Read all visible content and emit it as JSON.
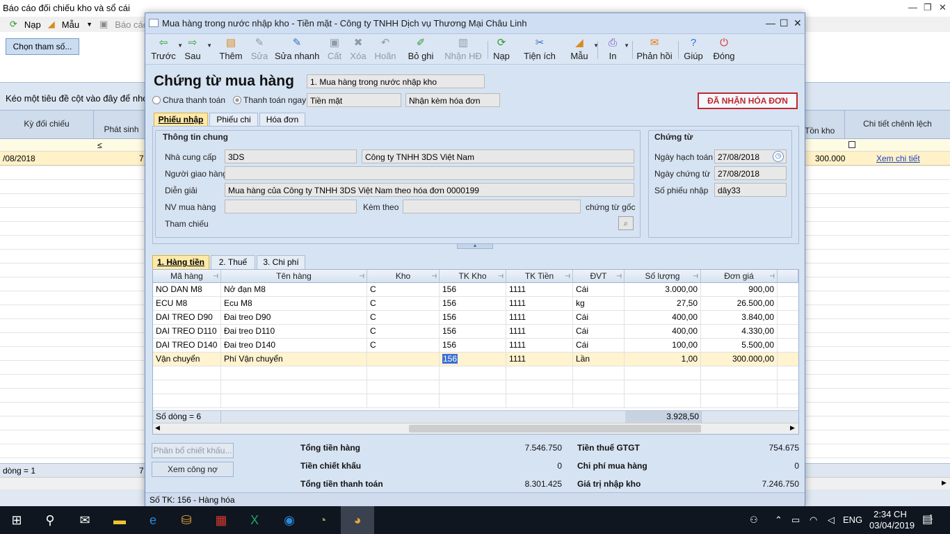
{
  "background_window": {
    "title": "Báo cáo đối chiếu kho và sổ cái",
    "toolbar": {
      "nap": "Nạp",
      "mau": "Mẫu",
      "bao_cao": "Báo cáo đ"
    },
    "chon_tham_so": "Chọn tham số...",
    "group_hint": "Kéo một tiêu đề cột vào đây để nhóm",
    "columns": {
      "ky_doi_chieu": "Kỳ đối chiếu",
      "phat_sinh": "Phát sinh",
      "ton_kho": "Tồn kho",
      "chi_tiet": "Chi tiết chênh lệch"
    },
    "filter_op": "≤",
    "row": {
      "ky": "/08/2018",
      "phat_sinh": "7",
      "ton_kho": "300.000",
      "link": "Xem chi tiết"
    },
    "footer_count": "dòng = 1",
    "footer_val": "7"
  },
  "dialog": {
    "title": "Mua hàng trong nước nhập kho - Tiền mặt - Công ty TNHH Dịch vụ Thương Mại Châu Linh",
    "toolbar": [
      {
        "label": "Trước",
        "icon": "arrow-left-icon",
        "glyph": "⇦",
        "color": "#2c9a2c",
        "disabled": false
      },
      {
        "label": "Sau",
        "icon": "arrow-right-icon",
        "glyph": "⇨",
        "color": "#2c9a2c",
        "disabled": false
      },
      {
        "label": "Thêm",
        "icon": "add-doc-icon",
        "glyph": "▤",
        "color": "#d98b1c",
        "disabled": false
      },
      {
        "label": "Sửa",
        "icon": "edit-icon",
        "glyph": "✎",
        "color": "#8d9aaa",
        "disabled": true
      },
      {
        "label": "Sửa nhanh",
        "icon": "quick-edit-icon",
        "glyph": "✎",
        "color": "#3a6fc4",
        "disabled": false
      },
      {
        "label": "Cất",
        "icon": "save-icon",
        "glyph": "▣",
        "color": "#8d9aaa",
        "disabled": true
      },
      {
        "label": "Xóa",
        "icon": "delete-icon",
        "glyph": "✖",
        "color": "#8d9aaa",
        "disabled": true
      },
      {
        "label": "Hoãn",
        "icon": "undo-icon",
        "glyph": "↶",
        "color": "#8d9aaa",
        "disabled": true
      },
      {
        "label": "Bỏ ghi",
        "icon": "unpost-icon",
        "glyph": "✐",
        "color": "#2c9a2c",
        "disabled": false
      },
      {
        "label": "Nhận HĐ",
        "icon": "receive-invoice-icon",
        "glyph": "▥",
        "color": "#8d9aaa",
        "disabled": true
      },
      {
        "label": "Nạp",
        "icon": "reload-icon",
        "glyph": "⟳",
        "color": "#2c9a2c",
        "disabled": false
      },
      {
        "label": "Tiện ích",
        "icon": "tools-icon",
        "glyph": "✂",
        "color": "#3a6fc4",
        "disabled": false
      },
      {
        "label": "Mẫu",
        "icon": "template-icon",
        "glyph": "◢",
        "color": "#d98b1c",
        "disabled": false
      },
      {
        "label": "In",
        "icon": "print-icon",
        "glyph": "⎙",
        "color": "#6b56b8",
        "disabled": false
      },
      {
        "label": "Phản hồi",
        "icon": "feedback-icon",
        "glyph": "✉",
        "color": "#e67e22",
        "disabled": false
      },
      {
        "label": "Giúp",
        "icon": "help-icon",
        "glyph": "?",
        "color": "#2a6fd8",
        "disabled": false
      },
      {
        "label": "Đóng",
        "icon": "close-power-icon",
        "glyph": "⏻",
        "color": "#d6342c",
        "disabled": false
      }
    ],
    "doc_title": "Chứng từ mua hàng",
    "doc_type": "1. Mua hàng trong nước nhập kho",
    "radio_unpaid": "Chưa thanh toán",
    "radio_paid": "Thanh toán ngay",
    "payment_method": "Tiền mặt",
    "invoice_option": "Nhận kèm hóa đơn",
    "stamp": "ĐÃ NHẬN HÓA ĐƠN",
    "tabs": [
      "Phiếu nhập",
      "Phiếu chi",
      "Hóa đơn"
    ],
    "general": {
      "title": "Thông tin chung",
      "supplier_label": "Nhà cung cấp",
      "supplier_code": "3DS",
      "supplier_name": "Công ty TNHH 3DS Việt Nam",
      "deliverer_label": "Người giao hàng",
      "deliverer": "",
      "desc_label": "Diễn giải",
      "desc": "Mua hàng của Công ty TNHH 3DS Việt Nam theo hóa đơn 0000199",
      "buyer_label": "NV mua hàng",
      "attach_label": "Kèm theo",
      "attach_suffix": "chứng từ gốc",
      "ref_label": "Tham chiếu"
    },
    "voucher": {
      "title": "Chứng từ",
      "posting_date_label": "Ngày hạch toán",
      "posting_date": "27/08/2018",
      "voucher_date_label": "Ngày chứng từ",
      "voucher_date": "27/08/2018",
      "voucher_no_label": "Số phiếu nhập",
      "voucher_no": "dây33"
    },
    "detail_tabs": [
      "1. Hàng tiền",
      "2. Thuế",
      "3. Chi phí"
    ],
    "columns": [
      "Mã hàng",
      "Tên hàng",
      "Kho",
      "TK Kho",
      "TK Tiền",
      "ĐVT",
      "Số lượng",
      "Đơn giá"
    ],
    "rows": [
      {
        "ma": "NO DAN M8",
        "ten": "Nở đạn M8",
        "kho": "C",
        "tk_kho": "156",
        "tk_tien": "1111",
        "dvt": "Cái",
        "sl": "3.000,00",
        "dg": "900,00"
      },
      {
        "ma": "ECU M8",
        "ten": "Ecu M8",
        "kho": "C",
        "tk_kho": "156",
        "tk_tien": "1111",
        "dvt": "kg",
        "sl": "27,50",
        "dg": "26.500,00"
      },
      {
        "ma": "DAI TREO D90",
        "ten": "Đai treo D90",
        "kho": "C",
        "tk_kho": "156",
        "tk_tien": "1111",
        "dvt": "Cái",
        "sl": "400,00",
        "dg": "3.840,00"
      },
      {
        "ma": "DAI TREO D110",
        "ten": "Đai treo D110",
        "kho": "C",
        "tk_kho": "156",
        "tk_tien": "1111",
        "dvt": "Cái",
        "sl": "400,00",
        "dg": "4.330,00"
      },
      {
        "ma": "DAI TREO D140",
        "ten": "Đai treo D140",
        "kho": "C",
        "tk_kho": "156",
        "tk_tien": "1111",
        "dvt": "Cái",
        "sl": "100,00",
        "dg": "5.500,00"
      },
      {
        "ma": "Vận chuyển",
        "ten": "Phí Vận chuyển",
        "kho": "",
        "tk_kho": "156",
        "tk_tien": "1111",
        "dvt": "Lần",
        "sl": "1,00",
        "dg": "300.000,00"
      }
    ],
    "row_count": "Số dòng = 6",
    "total_qty": "3.928,50",
    "btn_discount": "Phân bổ chiết khấu...",
    "btn_debt": "Xem công nợ",
    "totals": {
      "goods_label": "Tổng tiền hàng",
      "goods": "7.546.750",
      "discount_label": "Tiền chiết khấu",
      "discount": "0",
      "payment_label": "Tổng tiền thanh toán",
      "payment": "8.301.425",
      "vat_label": "Tiền thuế GTGT",
      "vat": "754.675",
      "cost_label": "Chi phí mua hàng",
      "cost": "0",
      "import_label": "Giá trị nhập kho",
      "import": "7.246.750"
    },
    "status": "Số TK:  156 - Hàng hóa"
  },
  "taskbar": {
    "lang": "ENG",
    "time": "2:34 CH",
    "date": "03/04/2019",
    "notif_count": "1"
  }
}
